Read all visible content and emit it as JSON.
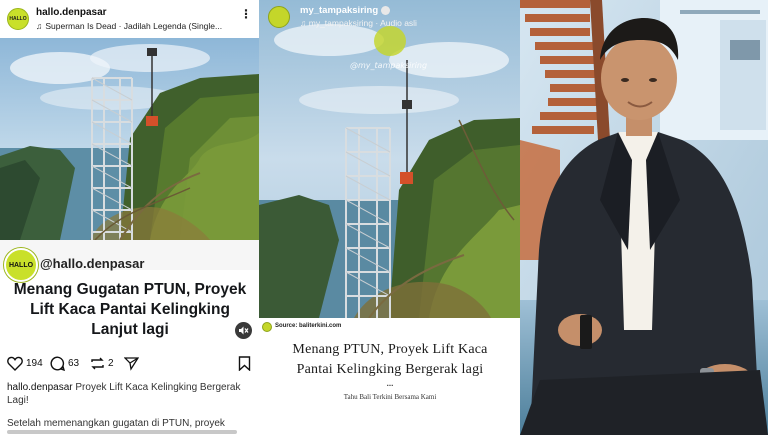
{
  "panel1": {
    "username": "hallo.denpasar",
    "avatar_text": "HALLO",
    "audio_note_icon": "music-note-icon",
    "audio_track": "Superman Is Dead · Jadilah Legenda (Single...",
    "more_icon": "more-vertical-icon",
    "overlay_logo_text": "HALLO",
    "overlay_handle": "@hallo.denpasar",
    "headline": "Menang Gugatan PTUN, Proyek Lift Kaca Pantai Kelingking Lanjut lagi",
    "mute_icon": "speaker-muted-icon",
    "likes": "194",
    "comments": "63",
    "reposts": "2",
    "caption_user": "hallo.denpasar",
    "caption_text": "Proyek Lift Kaca Kelingking Bergerak Lagi!",
    "body_text": "Setelah memenangkan gugatan di PTUN, proyek"
  },
  "panel2": {
    "username": "my_tampaksiring",
    "audio_label": "Audio asli",
    "watermark": "@my_tampaksiring",
    "source_label": "Source: baliterkini.com",
    "headline": "Menang PTUN, Proyek Lift Kaca Pantai Kelingking Bergerak lagi",
    "dots": "...",
    "tagline": "Tahu Bali Terkini Bersama Kami"
  },
  "colors": {
    "brand_lime": "#c9e02a",
    "text_dark": "#15171a",
    "sky": "#b4d0e6",
    "sea": "#2f5f72",
    "foliage": "#4e6b25",
    "stair": "#b4613a",
    "suit": "#262a31"
  }
}
